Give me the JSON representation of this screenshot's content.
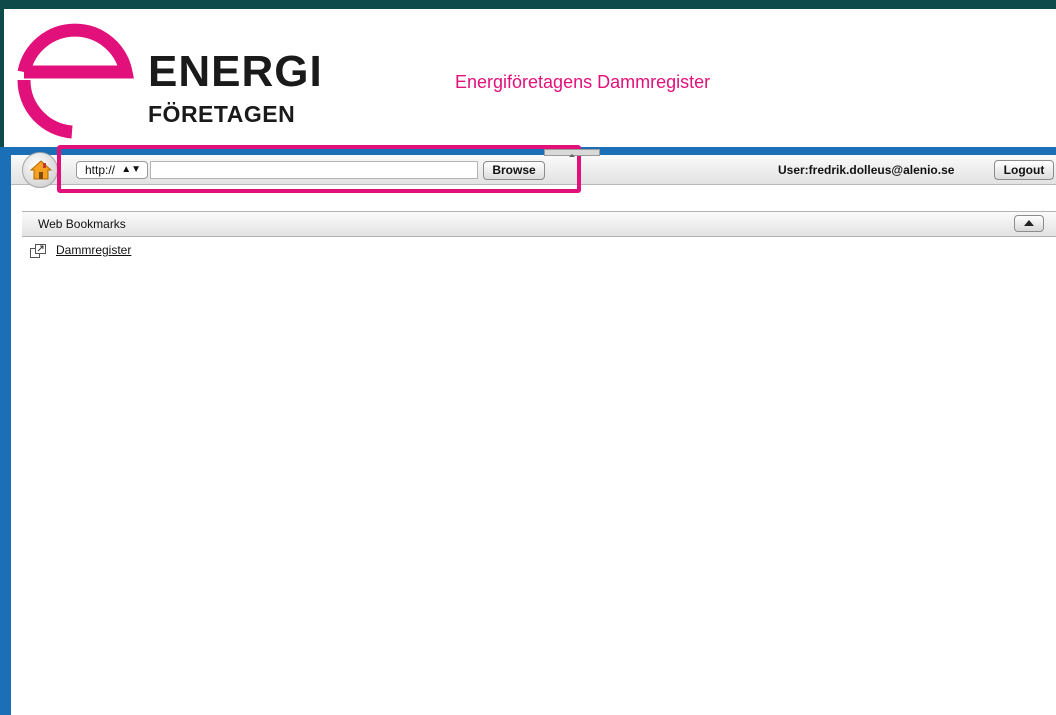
{
  "header": {
    "logo_line1": "ENERGI",
    "logo_line2": "FÖRETAGEN",
    "site_title": "Energiföretagens Dammregister"
  },
  "toolbar": {
    "home_icon": "home-icon",
    "protocol_select": "http://",
    "url_value": "",
    "browse_label": "Browse",
    "user_label": "User:fredrik.dolleus@alenio.se",
    "logout_label": "Logout"
  },
  "bookmarks": {
    "title": "Web Bookmarks",
    "items": [
      {
        "label": "Dammregister",
        "icon": "external-link-icon"
      }
    ]
  },
  "colors": {
    "brand_pink": "#e2107a",
    "brand_blue": "#1a6fb6",
    "top_bar": "#0f4a4a"
  }
}
